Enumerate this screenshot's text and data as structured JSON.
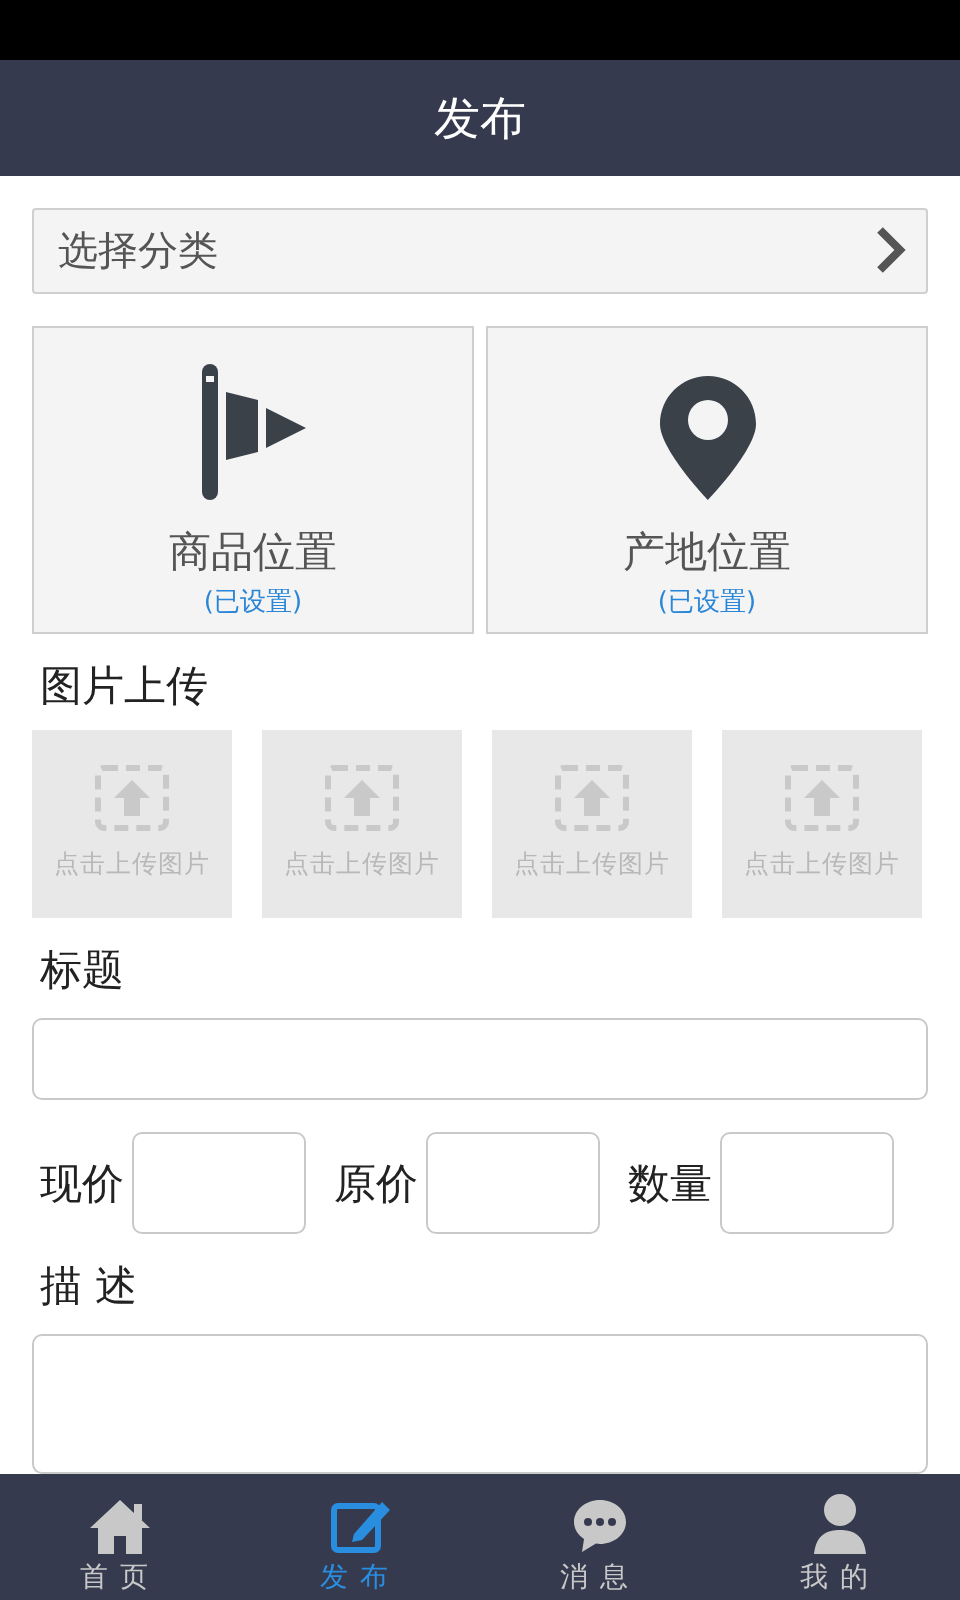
{
  "header": {
    "title": "发布"
  },
  "category": {
    "label": "选择分类"
  },
  "locations": [
    {
      "kind": "flag",
      "label": "商品位置",
      "status": "(已设置)"
    },
    {
      "kind": "pin",
      "label": "产地位置",
      "status": "(已设置)"
    }
  ],
  "upload": {
    "title": "图片上传",
    "slots": [
      "点击上传图片",
      "点击上传图片",
      "点击上传图片",
      "点击上传图片"
    ]
  },
  "title_field": {
    "label": "标题"
  },
  "prices": [
    {
      "label": "现价"
    },
    {
      "label": "原价"
    },
    {
      "label": "数量"
    }
  ],
  "description": {
    "label": "描 述"
  },
  "tabs": [
    {
      "kind": "home",
      "label": "首页",
      "selected": false
    },
    {
      "kind": "edit",
      "label": "发布",
      "selected": true
    },
    {
      "kind": "chat",
      "label": "消息",
      "selected": false
    },
    {
      "kind": "user",
      "label": "我的",
      "selected": false
    }
  ]
}
